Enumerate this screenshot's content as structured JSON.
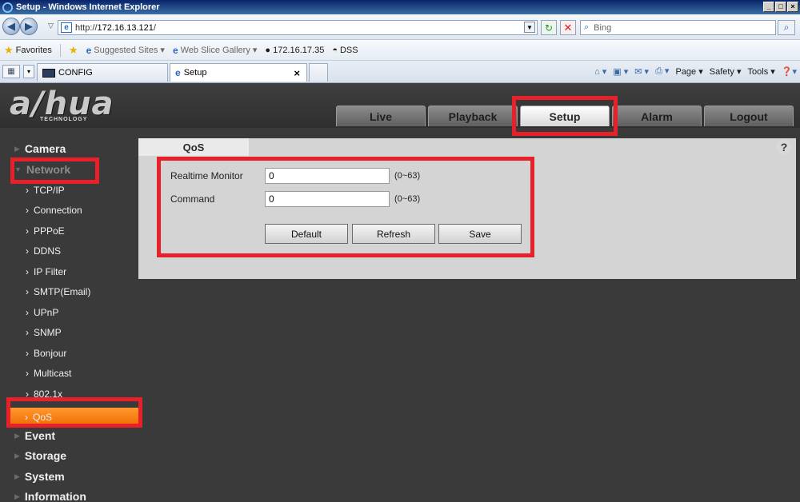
{
  "browser": {
    "window_title": "Setup - Windows Internet Explorer",
    "address": {
      "scheme": "http://",
      "host": "172.16.13.121",
      "path": "/"
    },
    "search_placeholder": "Bing",
    "favorites": {
      "favorites_label": "Favorites",
      "items": [
        "Suggested Sites ▾",
        "Web Slice Gallery ▾",
        "172.16.17.35",
        "DSS"
      ]
    },
    "tabs": [
      {
        "label": "CONFIG",
        "active": false
      },
      {
        "label": "Setup",
        "active": true
      }
    ],
    "command_bar": {
      "page": "Page ▾",
      "safety": "Safety ▾",
      "tools": "Tools ▾"
    }
  },
  "app": {
    "logo_text": "a/hua",
    "logo_subtitle": "TECHNOLOGY",
    "nav_tabs": [
      {
        "label": "Live",
        "active": false
      },
      {
        "label": "Playback",
        "active": false
      },
      {
        "label": "Setup",
        "active": true
      },
      {
        "label": "Alarm",
        "active": false
      },
      {
        "label": "Logout",
        "active": false
      }
    ],
    "sidebar": {
      "categories": [
        "Camera",
        "Network",
        "Event",
        "Storage",
        "System",
        "Information"
      ],
      "network_items": [
        "TCP/IP",
        "Connection",
        "PPPoE",
        "DDNS",
        "IP Filter",
        "SMTP(Email)",
        "UPnP",
        "SNMP",
        "Bonjour",
        "Multicast",
        "802.1x",
        "QoS"
      ],
      "selected": "QoS"
    },
    "content": {
      "tab_title": "QoS",
      "help": "?",
      "fields": [
        {
          "label": "Realtime Monitor",
          "value": "0",
          "range": "(0~63)"
        },
        {
          "label": "Command",
          "value": "0",
          "range": "(0~63)"
        }
      ],
      "buttons": {
        "default": "Default",
        "refresh": "Refresh",
        "save": "Save"
      }
    }
  },
  "colors": {
    "annotation_red": "#e8202a",
    "selected_orange": "#f47a10",
    "app_background": "#3a3a3a"
  }
}
